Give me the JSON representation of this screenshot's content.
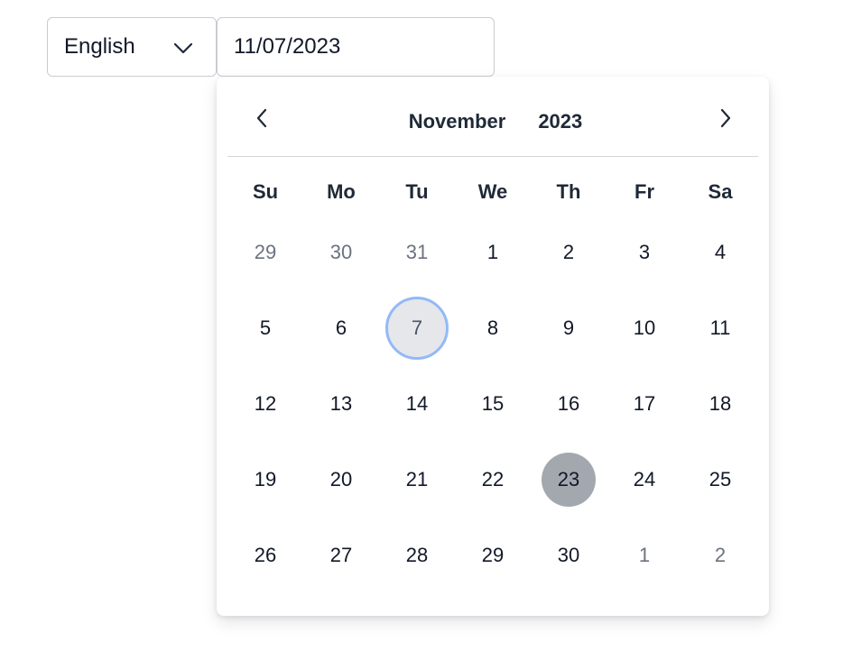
{
  "language_select": {
    "value": "English",
    "icon": "chevron-down-icon"
  },
  "date_input": {
    "value": "11/07/2023"
  },
  "calendar": {
    "month": "November",
    "year": "2023",
    "prev_icon": "chevron-left-icon",
    "next_icon": "chevron-right-icon",
    "weekdays": [
      "Su",
      "Mo",
      "Tu",
      "We",
      "Th",
      "Fr",
      "Sa"
    ],
    "today": "7",
    "selected": "23",
    "colors": {
      "today_ring": "#93b9f7",
      "today_fill": "#e5e7eb",
      "selected_fill": "#a3a8ae"
    },
    "days": [
      {
        "label": "29",
        "outside": true
      },
      {
        "label": "30",
        "outside": true
      },
      {
        "label": "31",
        "outside": true
      },
      {
        "label": "1",
        "outside": false
      },
      {
        "label": "2",
        "outside": false
      },
      {
        "label": "3",
        "outside": false
      },
      {
        "label": "4",
        "outside": false
      },
      {
        "label": "5",
        "outside": false
      },
      {
        "label": "6",
        "outside": false
      },
      {
        "label": "7",
        "outside": false,
        "today": true
      },
      {
        "label": "8",
        "outside": false
      },
      {
        "label": "9",
        "outside": false
      },
      {
        "label": "10",
        "outside": false
      },
      {
        "label": "11",
        "outside": false
      },
      {
        "label": "12",
        "outside": false
      },
      {
        "label": "13",
        "outside": false
      },
      {
        "label": "14",
        "outside": false
      },
      {
        "label": "15",
        "outside": false
      },
      {
        "label": "16",
        "outside": false
      },
      {
        "label": "17",
        "outside": false
      },
      {
        "label": "18",
        "outside": false
      },
      {
        "label": "19",
        "outside": false
      },
      {
        "label": "20",
        "outside": false
      },
      {
        "label": "21",
        "outside": false
      },
      {
        "label": "22",
        "outside": false
      },
      {
        "label": "23",
        "outside": false,
        "selected": true
      },
      {
        "label": "24",
        "outside": false
      },
      {
        "label": "25",
        "outside": false
      },
      {
        "label": "26",
        "outside": false
      },
      {
        "label": "27",
        "outside": false
      },
      {
        "label": "28",
        "outside": false
      },
      {
        "label": "29",
        "outside": false
      },
      {
        "label": "30",
        "outside": false
      },
      {
        "label": "1",
        "outside": true
      },
      {
        "label": "2",
        "outside": true
      }
    ]
  }
}
